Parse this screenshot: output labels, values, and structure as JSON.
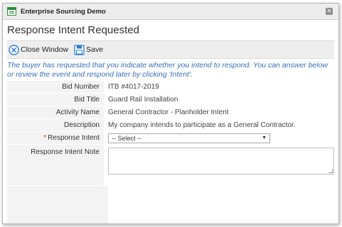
{
  "window": {
    "title": "Enterprise Sourcing Demo"
  },
  "page": {
    "heading": "Response Intent Requested"
  },
  "toolbar": {
    "close_label": "Close Window",
    "save_label": "Save"
  },
  "notice": "The buyer has requested that you indicate whether you intend to respond. You can answer below or review the event and respond later by clicking 'Intent'.",
  "form": {
    "bid_number_label": "Bid Number",
    "bid_number_value": "ITB #4017-2019",
    "bid_title_label": "Bid Title",
    "bid_title_value": "Guard Rail Installation",
    "activity_name_label": "Activity Name",
    "activity_name_value": "General Contractor - Planholder Intent",
    "description_label": "Description",
    "description_value": "My company intends to participate as a General Contractor.",
    "required_marker": "*",
    "response_intent_label": "Response Intent",
    "response_intent_selected": "-- Select --",
    "response_intent_note_label": "Response Intent Note",
    "response_intent_note_value": ""
  },
  "colors": {
    "notice_text": "#3a6fb8",
    "icon_blue": "#2b7bd4",
    "required": "#d22222"
  }
}
